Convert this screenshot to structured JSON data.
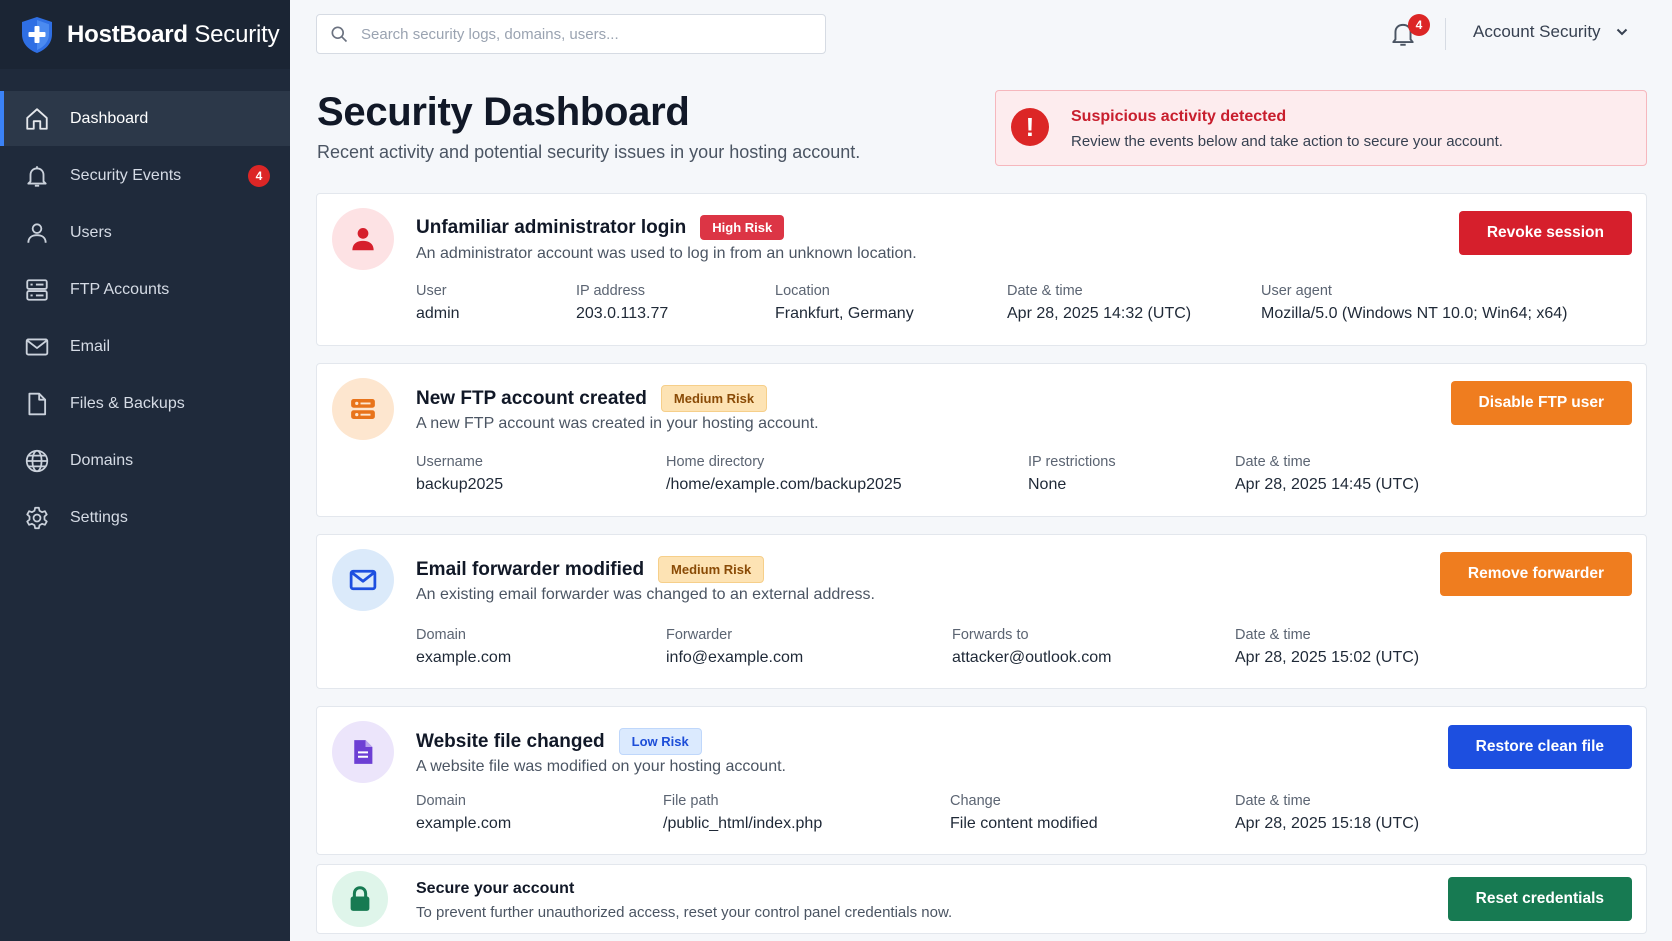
{
  "brand": {
    "name_bold": "HostBoard",
    "name_light": " Security"
  },
  "sidebar": {
    "items": [
      {
        "label": "Dashboard",
        "icon": "home-icon",
        "active": true
      },
      {
        "label": "Security Events",
        "icon": "bell-icon",
        "badge": "4"
      },
      {
        "label": "Users",
        "icon": "user-icon"
      },
      {
        "label": "FTP Accounts",
        "icon": "server-icon"
      },
      {
        "label": "Email",
        "icon": "mail-icon"
      },
      {
        "label": "Files & Backups",
        "icon": "file-icon"
      },
      {
        "label": "Domains",
        "icon": "globe-icon"
      },
      {
        "label": "Settings",
        "icon": "gear-icon"
      }
    ]
  },
  "topbar": {
    "search_placeholder": "Search security logs, domains, users...",
    "notification_count": "4",
    "account_label": "Account Security"
  },
  "header": {
    "title": "Security Dashboard",
    "subtitle": "Recent activity and potential security issues in your hosting account."
  },
  "alert": {
    "title": "Suspicious activity detected",
    "text": "Review the events below and take action to secure your account."
  },
  "events": [
    {
      "title": "Unfamiliar administrator login",
      "risk": "High Risk",
      "description": "An administrator account was used to log in from an unknown location.",
      "action": "Revoke session",
      "fields": [
        {
          "label": "User",
          "value": "admin"
        },
        {
          "label": "IP address",
          "value": "203.0.113.77"
        },
        {
          "label": "Location",
          "value": "Frankfurt, Germany"
        },
        {
          "label": "Date & time",
          "value": "Apr 28, 2025 14:32 (UTC)"
        },
        {
          "label": "User agent",
          "value": "Mozilla/5.0 (Windows NT 10.0; Win64; x64)"
        }
      ]
    },
    {
      "title": "New FTP account created",
      "risk": "Medium Risk",
      "description": "A new FTP account was created in your hosting account.",
      "action": "Disable FTP user",
      "fields": [
        {
          "label": "Username",
          "value": "backup2025"
        },
        {
          "label": "Home directory",
          "value": "/home/example.com/backup2025"
        },
        {
          "label": "IP restrictions",
          "value": "None"
        },
        {
          "label": "Date & time",
          "value": "Apr 28, 2025 14:45 (UTC)"
        }
      ]
    },
    {
      "title": "Email forwarder modified",
      "risk": "Medium Risk",
      "description": "An existing email forwarder was changed to an external address.",
      "action": "Remove forwarder",
      "fields": [
        {
          "label": "Domain",
          "value": "example.com"
        },
        {
          "label": "Forwarder",
          "value": "info@example.com"
        },
        {
          "label": "Forwards to",
          "value": "attacker@outlook.com"
        },
        {
          "label": "Date & time",
          "value": "Apr 28, 2025 15:02 (UTC)"
        }
      ]
    },
    {
      "title": "Website file changed",
      "risk": "Low Risk",
      "description": "A website file was modified on your hosting account.",
      "action": "Restore clean file",
      "fields": [
        {
          "label": "Domain",
          "value": "example.com"
        },
        {
          "label": "File path",
          "value": "/public_html/index.php"
        },
        {
          "label": "Change",
          "value": "File content modified"
        },
        {
          "label": "Date & time",
          "value": "Apr 28, 2025 15:18 (UTC)"
        }
      ]
    }
  ],
  "secure": {
    "title": "Secure your account",
    "text": "To prevent further unauthorized access, reset your control panel credentials now.",
    "action": "Reset credentials"
  },
  "colors": {
    "sidebar_bg": "#1f2a3b",
    "accent": "#3b82f6",
    "danger": "#dc2626",
    "warning": "#ef7d1f",
    "info": "#1d4fe0",
    "success": "#177a52"
  }
}
